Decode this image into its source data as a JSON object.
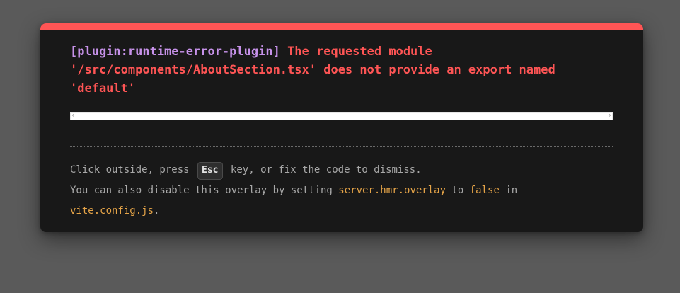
{
  "overlay": {
    "plugin_tag": "[plugin:runtime-error-plugin]",
    "error_message": "The requested module '/src/components/AboutSection.tsx' does not provide an export named 'default'",
    "tip": {
      "line1_before": "Click outside, press ",
      "esc_key": "Esc",
      "line1_after": " key, or fix the code to dismiss.",
      "line2_before": "You can also disable this overlay by setting ",
      "setting_name": "server.hmr.overlay",
      "line2_middle": " to ",
      "setting_value": "false",
      "line2_after": " in",
      "config_file": "vite.config.js",
      "line3_after": "."
    },
    "scroll_left_glyph": "‹",
    "scroll_right_glyph": "›"
  },
  "colors": {
    "accent_bar": "#ff5555",
    "plugin_color": "#c792ea",
    "error_color": "#ff5555",
    "code_color": "#e5a448",
    "background": "#181818"
  }
}
